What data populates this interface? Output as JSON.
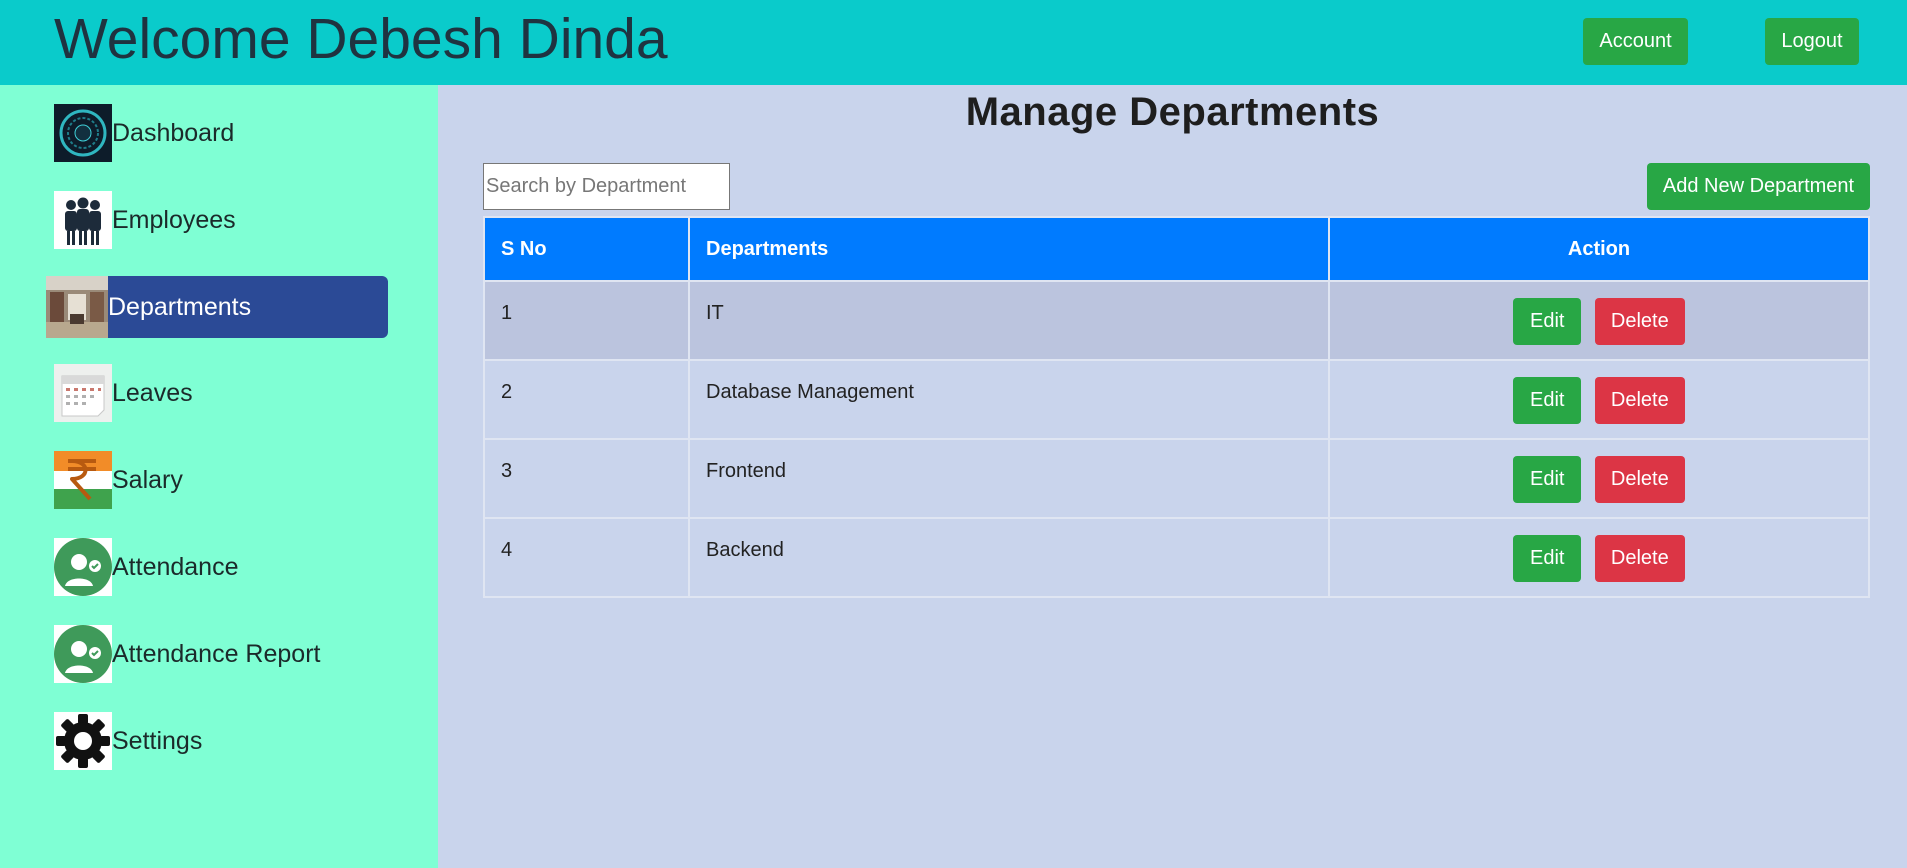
{
  "header": {
    "welcome_text": "Welcome Debesh Dinda",
    "account_label": "Account",
    "logout_label": "Logout"
  },
  "sidebar": {
    "items": [
      {
        "label": "Dashboard",
        "icon": "dashboard-icon"
      },
      {
        "label": "Employees",
        "icon": "employees-icon"
      },
      {
        "label": "Departments",
        "icon": "departments-icon",
        "active": true
      },
      {
        "label": "Leaves",
        "icon": "calendar-icon"
      },
      {
        "label": "Salary",
        "icon": "rupee-icon"
      },
      {
        "label": "Attendance",
        "icon": "attendance-icon"
      },
      {
        "label": "Attendance Report",
        "icon": "attendance-report-icon"
      },
      {
        "label": "Settings",
        "icon": "gear-icon"
      }
    ]
  },
  "main": {
    "title": "Manage Departments",
    "search_placeholder": "Search by Department",
    "add_label": "Add New Department",
    "columns": [
      "S No",
      "Departments",
      "Action"
    ],
    "rows": [
      {
        "sno": "1",
        "department": "IT"
      },
      {
        "sno": "2",
        "department": "Database Management"
      },
      {
        "sno": "3",
        "department": "Frontend"
      },
      {
        "sno": "4",
        "department": "Backend"
      }
    ],
    "edit_label": "Edit",
    "delete_label": "Delete"
  },
  "colors": {
    "header_bg": "#0acbcb",
    "sidebar_bg": "#7fffd4",
    "active_item": "#2b4a96",
    "table_header": "#007bff",
    "success": "#28a745",
    "danger": "#dc3545"
  }
}
